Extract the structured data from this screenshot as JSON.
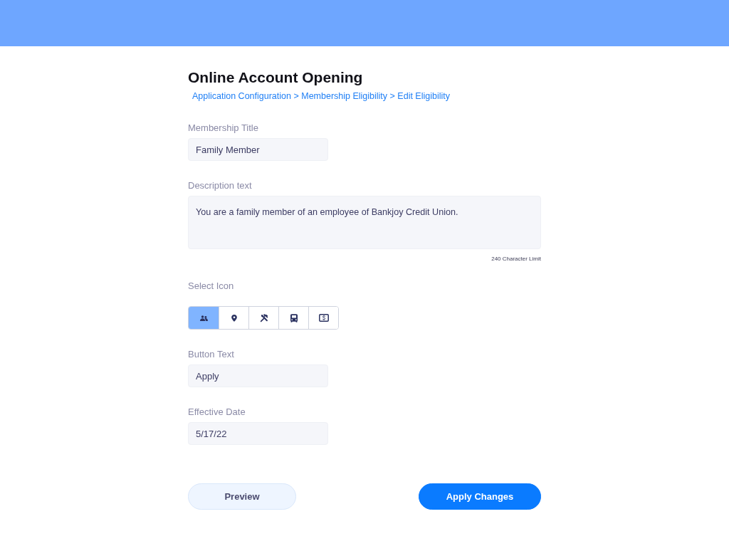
{
  "page": {
    "title": "Online Account Opening",
    "breadcrumb": "Application Configuration > Membership Eligibility > Edit Eligibility"
  },
  "fields": [
    {
      "kind": "text",
      "label": "Membership Title",
      "value": "Family Member"
    },
    {
      "kind": "textarea",
      "label": "Description text",
      "value": "You are a family member of an employee of Bankjoy Credit Union.",
      "hint": "240 Character Limit"
    },
    {
      "kind": "icons",
      "label": "Select Icon",
      "options": [
        {
          "kind": "people",
          "selected": true
        },
        {
          "kind": "pin",
          "selected": false
        },
        {
          "kind": "tools",
          "selected": false
        },
        {
          "kind": "bus",
          "selected": false
        },
        {
          "kind": "money",
          "selected": false
        }
      ]
    },
    {
      "kind": "text",
      "label": "Button Text",
      "value": "Apply"
    },
    {
      "kind": "text",
      "label": "Effective Date",
      "value": "5/17/22"
    }
  ],
  "buttons": [
    {
      "kind": "secondary",
      "label": "Preview"
    },
    {
      "kind": "primary",
      "label": "Apply Changes"
    }
  ]
}
